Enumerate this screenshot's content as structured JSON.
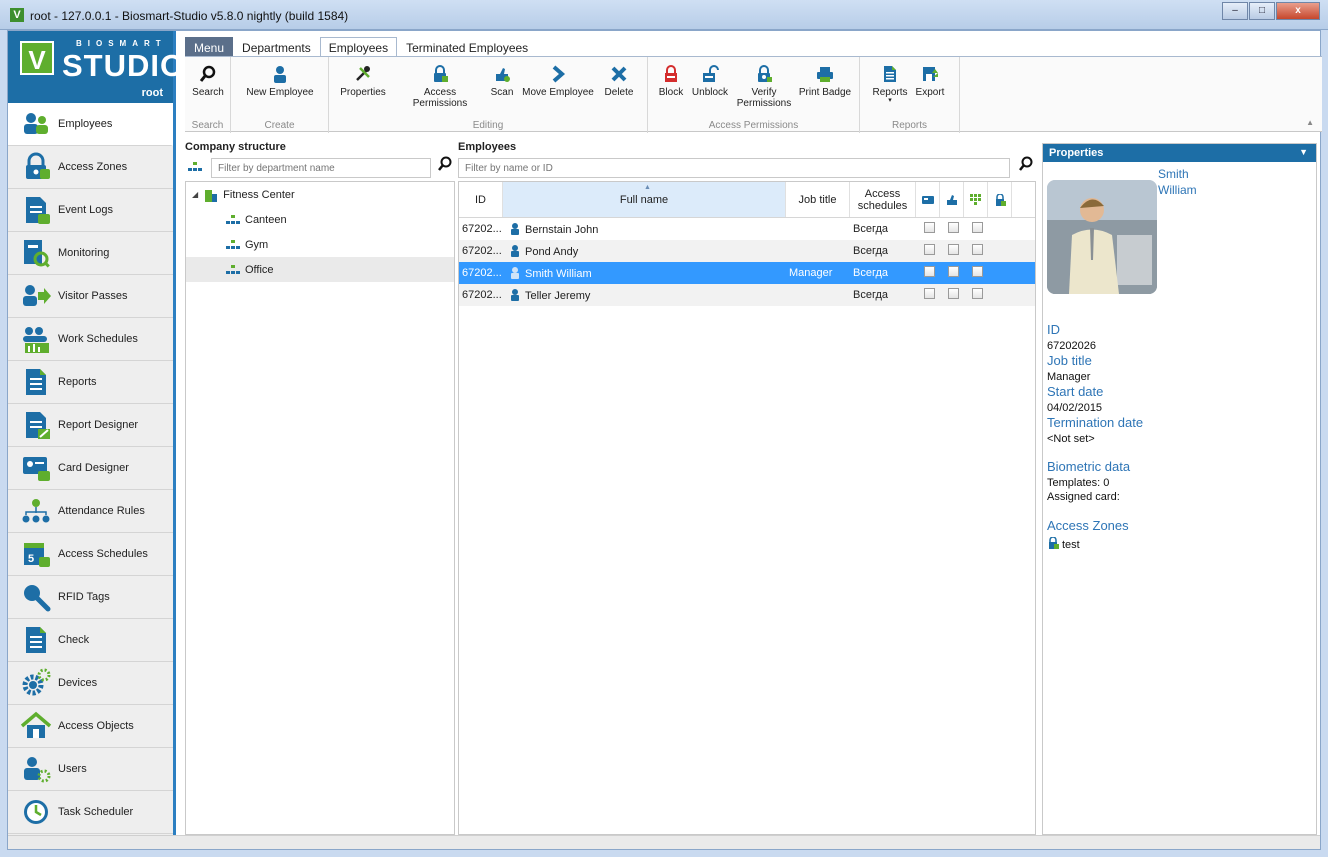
{
  "window": {
    "title": "root - 127.0.0.1 - Biosmart-Studio v5.8.0 nightly (build 1584)",
    "minimize": "–",
    "maximize": "□",
    "close": "x"
  },
  "brand": {
    "logo_letter": "V",
    "top": "BIOSMART",
    "name": "STUDIO",
    "user": "root"
  },
  "nav": {
    "items": [
      {
        "label": "Employees"
      },
      {
        "label": "Access Zones"
      },
      {
        "label": "Event Logs"
      },
      {
        "label": "Monitoring"
      },
      {
        "label": "Visitor Passes"
      },
      {
        "label": "Work Schedules"
      },
      {
        "label": "Reports"
      },
      {
        "label": "Report Designer"
      },
      {
        "label": "Card Designer"
      },
      {
        "label": "Attendance Rules"
      },
      {
        "label": "Access Schedules"
      },
      {
        "label": "RFID Tags"
      },
      {
        "label": "Check"
      },
      {
        "label": "Devices"
      },
      {
        "label": "Access Objects"
      },
      {
        "label": "Users"
      },
      {
        "label": "Task Scheduler"
      }
    ]
  },
  "ribbon": {
    "tabs": [
      "Menu",
      "Departments",
      "Employees",
      "Terminated Employees"
    ],
    "groups": {
      "search": "Search",
      "create": "Create",
      "editing": "Editing",
      "access_permissions": "Access Permissions",
      "reports": "Reports"
    },
    "buttons": {
      "search": "Search",
      "new_employee": "New Employee",
      "properties": "Properties",
      "access_permissions": "Access Permissions",
      "scan": "Scan",
      "move_employee": "Move Employee",
      "delete": "Delete",
      "block": "Block",
      "unblock": "Unblock",
      "verify_line1": "Verify",
      "verify_line2": "Permissions",
      "print_badge": "Print Badge",
      "reports": "Reports",
      "export": "Export"
    }
  },
  "company": {
    "title": "Company structure",
    "filter_placeholder": "Filter by department name",
    "tree": {
      "root": "Fitness Center",
      "children": [
        "Canteen",
        "Gym",
        "Office"
      ]
    }
  },
  "employees": {
    "title": "Employees",
    "filter_placeholder": "Filter by name or ID",
    "columns": {
      "id": "ID",
      "full_name": "Full name",
      "job_title": "Job title",
      "access_schedules": "Access schedules"
    },
    "rows": [
      {
        "id": "67202...",
        "name": "Bernstain John",
        "job": "",
        "schedule": "Всегда"
      },
      {
        "id": "67202...",
        "name": "Pond Andy",
        "job": "",
        "schedule": "Всегда"
      },
      {
        "id": "67202...",
        "name": "Smith William",
        "job": "Manager",
        "schedule": "Всегда"
      },
      {
        "id": "67202...",
        "name": "Teller Jeremy",
        "job": "",
        "schedule": "Всегда"
      }
    ]
  },
  "properties": {
    "title": "Properties",
    "name_line1": "Smith",
    "name_line2": "William",
    "id_label": "ID",
    "id_value": "67202026",
    "job_label": "Job title",
    "job_value": "Manager",
    "start_label": "Start date",
    "start_value": "04/02/2015",
    "term_label": "Termination date",
    "term_value": "<Not set>",
    "bio_label": "Biometric data",
    "templates": "Templates: 0",
    "card": "Assigned card:",
    "zones_label": "Access Zones",
    "zone": "test"
  },
  "colors": {
    "accent": "#1d6ea6",
    "selection": "#3399ff",
    "link": "#2e75b6",
    "logo_green": "#5fae2e"
  }
}
